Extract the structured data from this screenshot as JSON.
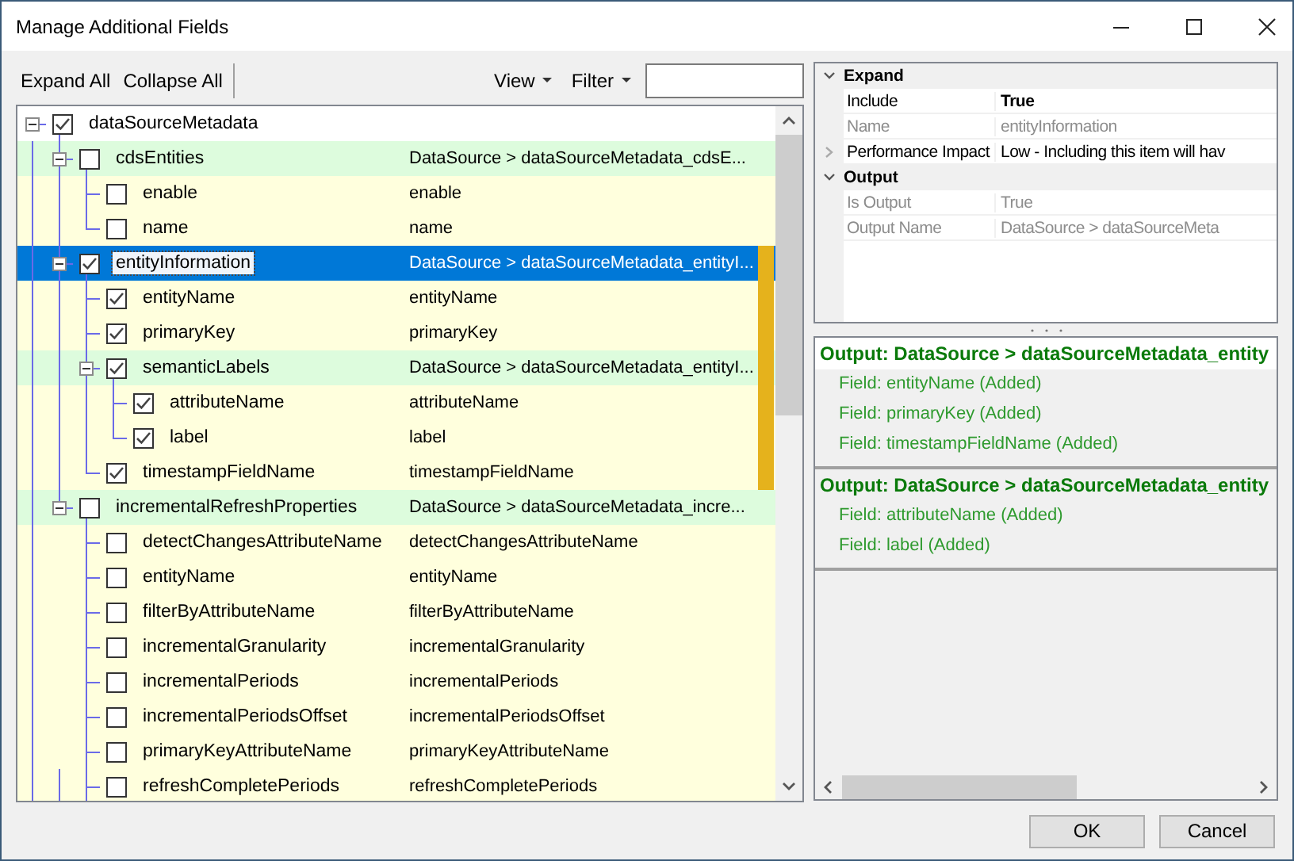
{
  "window": {
    "title": "Manage Additional Fields"
  },
  "toolbar": {
    "expand_all": "Expand All",
    "collapse_all": "Collapse All",
    "view": "View",
    "filter": "Filter"
  },
  "tree": [
    {
      "name": "dataSourceMetadata",
      "checked": true,
      "expanded": true,
      "selected": false,
      "flagged": false,
      "children": [
        {
          "name": "cdsEntities",
          "output": "DataSource > dataSourceMetadata_cdsE...",
          "checked": false,
          "expanded": true,
          "selected": false,
          "flagged": false,
          "children": [
            {
              "name": "enable",
              "output": "enable",
              "checked": false,
              "selected": false,
              "flagged": false
            },
            {
              "name": "name",
              "output": "name",
              "checked": false,
              "selected": false,
              "flagged": false
            }
          ]
        },
        {
          "name": "entityInformation",
          "output": "DataSource > dataSourceMetadata_entityI...",
          "checked": true,
          "expanded": true,
          "selected": true,
          "flagged": true,
          "children": [
            {
              "name": "entityName",
              "output": "entityName",
              "checked": true,
              "selected": false,
              "flagged": true
            },
            {
              "name": "primaryKey",
              "output": "primaryKey",
              "checked": true,
              "selected": false,
              "flagged": true
            },
            {
              "name": "semanticLabels",
              "output": "DataSource > dataSourceMetadata_entityI...",
              "checked": true,
              "expanded": true,
              "selected": false,
              "flagged": true,
              "children": [
                {
                  "name": "attributeName",
                  "output": "attributeName",
                  "checked": true,
                  "selected": false,
                  "flagged": true
                },
                {
                  "name": "label",
                  "output": "label",
                  "checked": true,
                  "selected": false,
                  "flagged": true
                }
              ]
            },
            {
              "name": "timestampFieldName",
              "output": "timestampFieldName",
              "checked": true,
              "selected": false,
              "flagged": true
            }
          ]
        },
        {
          "name": "incrementalRefreshProperties",
          "output": "DataSource > dataSourceMetadata_incre...",
          "checked": false,
          "expanded": true,
          "selected": false,
          "flagged": false,
          "children": [
            {
              "name": "detectChangesAttributeName",
              "output": "detectChangesAttributeName",
              "checked": false,
              "selected": false,
              "flagged": false
            },
            {
              "name": "entityName",
              "output": "entityName",
              "checked": false,
              "selected": false,
              "flagged": false
            },
            {
              "name": "filterByAttributeName",
              "output": "filterByAttributeName",
              "checked": false,
              "selected": false,
              "flagged": false
            },
            {
              "name": "incrementalGranularity",
              "output": "incrementalGranularity",
              "checked": false,
              "selected": false,
              "flagged": false
            },
            {
              "name": "incrementalPeriods",
              "output": "incrementalPeriods",
              "checked": false,
              "selected": false,
              "flagged": false
            },
            {
              "name": "incrementalPeriodsOffset",
              "output": "incrementalPeriodsOffset",
              "checked": false,
              "selected": false,
              "flagged": false
            },
            {
              "name": "primaryKeyAttributeName",
              "output": "primaryKeyAttributeName",
              "checked": false,
              "selected": false,
              "flagged": false
            },
            {
              "name": "refreshCompletePeriods",
              "output": "refreshCompletePeriods",
              "checked": false,
              "selected": false,
              "flagged": false
            }
          ]
        }
      ]
    }
  ],
  "property_grid": [
    {
      "name": "Expand",
      "expanded": true,
      "properties": [
        {
          "name": "Include",
          "value": "True",
          "disabled": false,
          "modified": true
        },
        {
          "name": "Name",
          "value": "entityInformation",
          "disabled": true,
          "modified": false
        },
        {
          "name": "Performance Impact",
          "value": "Low - Including this item will hav",
          "disabled": false,
          "modified": false,
          "expandable": true
        }
      ]
    },
    {
      "name": "Output",
      "expanded": true,
      "properties": [
        {
          "name": "Is Output",
          "value": "True",
          "disabled": true,
          "modified": false
        },
        {
          "name": "Output Name",
          "value": "DataSource > dataSourceMeta",
          "disabled": true,
          "modified": false
        }
      ]
    }
  ],
  "outputs": [
    {
      "title": "Output: DataSource > dataSourceMetadata_entity",
      "fields": [
        "Field: entityName (Added)",
        "Field: primaryKey (Added)",
        "Field: timestampFieldName (Added)"
      ]
    },
    {
      "title": "Output: DataSource > dataSourceMetadata_entity",
      "fields": [
        "Field: attributeName (Added)",
        "Field: label (Added)"
      ]
    }
  ],
  "buttons": [
    "OK",
    "Cancel"
  ]
}
